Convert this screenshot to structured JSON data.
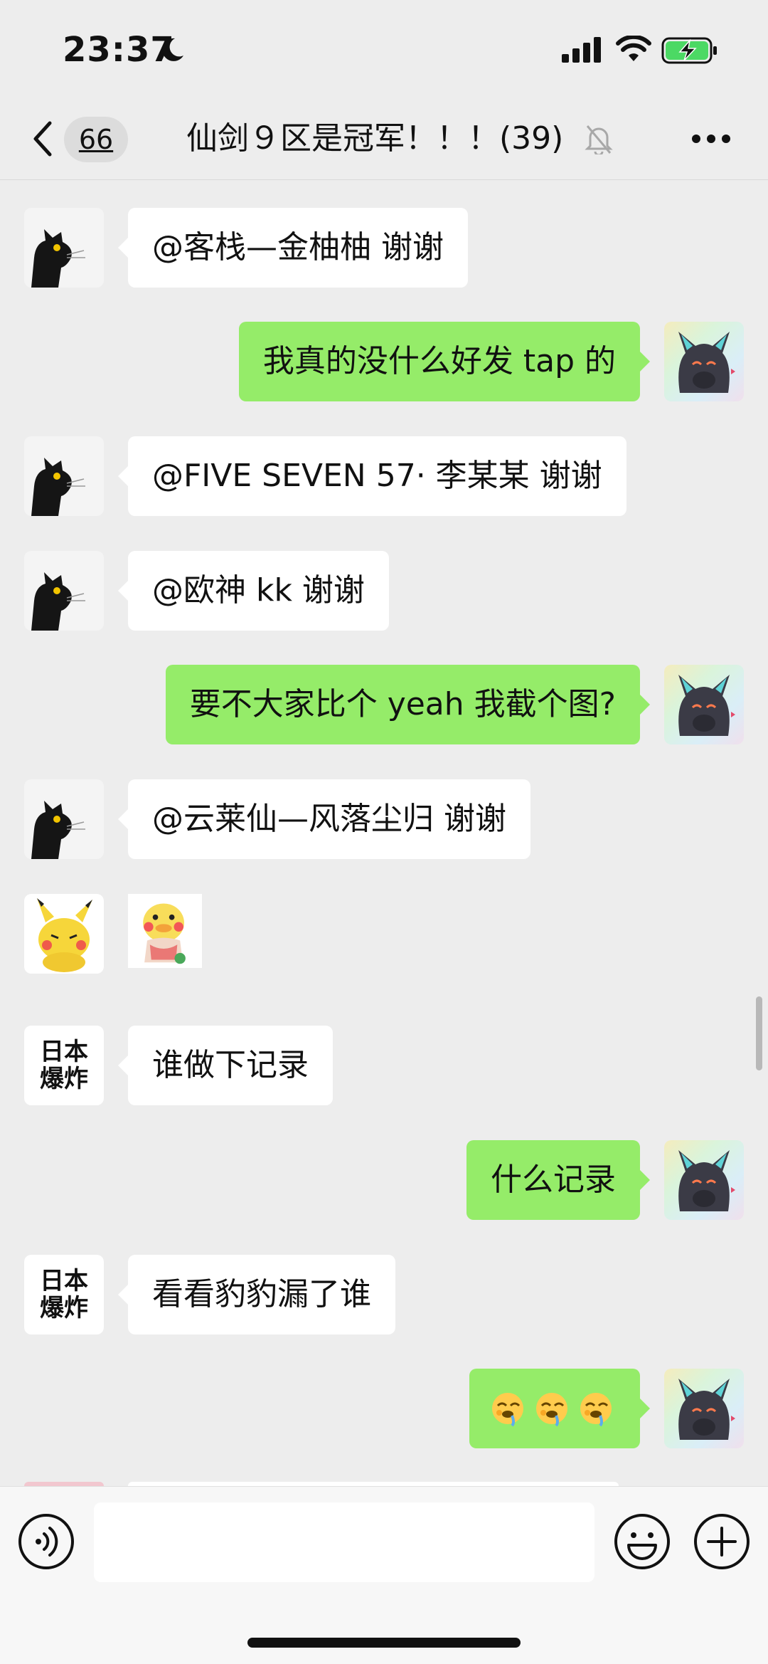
{
  "status_bar": {
    "time": "23:37"
  },
  "header": {
    "back_count": "66",
    "title": "仙剑９区是冠军！！！(39)"
  },
  "messages": [
    {
      "side": "in",
      "avatar": "black-cat-avatar",
      "text": "@客栈—金柚柚 谢谢"
    },
    {
      "side": "out",
      "avatar": "my-cat-avatar",
      "text": "我真的没什么好发 tap 的"
    },
    {
      "side": "in",
      "avatar": "black-cat-avatar",
      "text": "@FIVE SEVEN 57· 李某某 谢谢"
    },
    {
      "side": "in",
      "avatar": "black-cat-avatar",
      "text": "@欧神 kk 谢谢"
    },
    {
      "side": "out",
      "avatar": "my-cat-avatar",
      "text": "要不大家比个 yeah 我截个图?"
    },
    {
      "side": "in",
      "avatar": "black-cat-avatar",
      "text": "@云莱仙—风落尘归 谢谢"
    },
    {
      "side": "in",
      "avatar": "pikachu-avatar",
      "sticker": "duck-sticker"
    },
    {
      "side": "in",
      "avatar_text_line1": "日本",
      "avatar_text_line2": "爆炸",
      "text": "谁做下记录"
    },
    {
      "side": "out",
      "avatar": "my-cat-avatar",
      "text": "什么记录"
    },
    {
      "side": "in",
      "avatar_text_line1": "日本",
      "avatar_text_line2": "爆炸",
      "text": "看看豹豹漏了谁"
    },
    {
      "side": "out",
      "avatar": "my-cat-avatar",
      "emoji": "🤤🤤🤤"
    }
  ],
  "colors": {
    "outgoing_bubble": "#95ec69",
    "incoming_bubble": "#ffffff",
    "background": "#ededed"
  },
  "input_bar": {
    "value": ""
  }
}
